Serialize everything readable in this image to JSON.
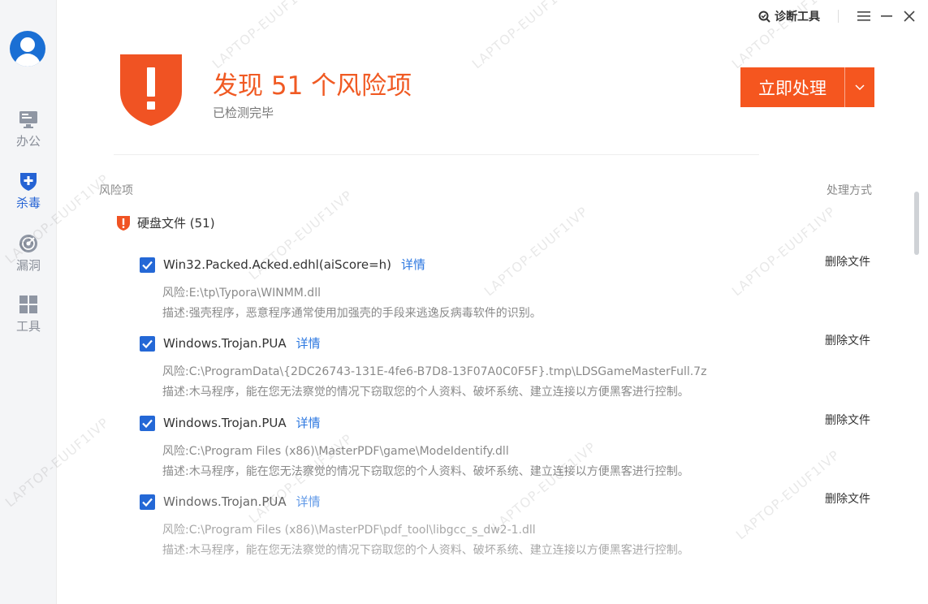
{
  "sidebar": {
    "items": [
      {
        "label": "办公",
        "icon": "monitor-icon",
        "active": false
      },
      {
        "label": "杀毒",
        "icon": "shield-plus-icon",
        "active": true
      },
      {
        "label": "漏洞",
        "icon": "radar-icon",
        "active": false
      },
      {
        "label": "工具",
        "icon": "grid-icon",
        "active": false
      }
    ]
  },
  "topbar": {
    "diagnose_label": "诊断工具"
  },
  "header": {
    "title": "发现 51 个风险项",
    "subtitle": "已检测完毕",
    "action_label": "立即处理"
  },
  "list": {
    "col_left": "风险项",
    "col_right": "处理方式",
    "group_label": "硬盘文件 (51)",
    "detail_label": "详情",
    "items": [
      {
        "name": "Win32.Packed.Acked.edhl(aiScore=h)",
        "path": "风险:E:\\tp\\Typora\\WINMM.dll",
        "desc": "描述:强壳程序，恶意程序通常使用加强壳的手段来逃逸反病毒软件的识别。",
        "action": "删除文件"
      },
      {
        "name": "Windows.Trojan.PUA",
        "path": "风险:C:\\ProgramData\\{2DC26743-131E-4fe6-B7D8-13F07A0C0F5F}.tmp\\LDSGameMasterFull.7z",
        "desc": "描述:木马程序，能在您无法察觉的情况下窃取您的个人资料、破坏系统、建立连接以方便黑客进行控制。",
        "action": "删除文件"
      },
      {
        "name": "Windows.Trojan.PUA",
        "path": "风险:C:\\Program Files (x86)\\MasterPDF\\game\\ModeIdentify.dll",
        "desc": "描述:木马程序，能在您无法察觉的情况下窃取您的个人资料、破坏系统、建立连接以方便黑客进行控制。",
        "action": "删除文件"
      },
      {
        "name": "Windows.Trojan.PUA",
        "path": "风险:C:\\Program Files (x86)\\MasterPDF\\pdf_tool\\libgcc_s_dw2-1.dll",
        "desc": "描述:木马程序，能在您无法察觉的情况下窃取您的个人资料、破坏系统、建立连接以方便黑客进行控制。",
        "action": "删除文件"
      }
    ]
  },
  "watermark": "LAPTOP-EUUF1IVP",
  "colors": {
    "accent": "#f5561f",
    "primary_blue": "#2468d6",
    "link_blue": "#2b77e0"
  }
}
